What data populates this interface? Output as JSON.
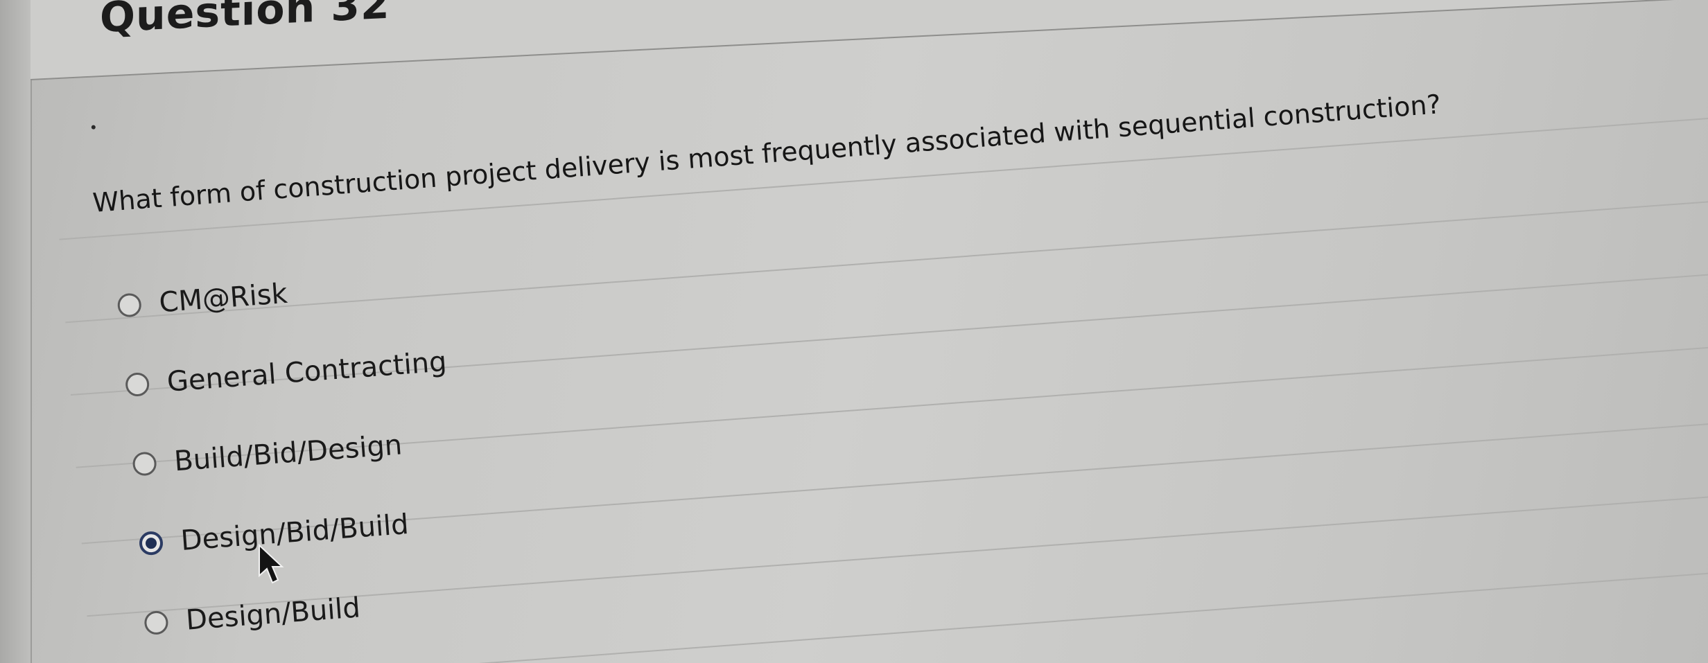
{
  "question": {
    "title": "Question 32",
    "prompt": "What form of construction project delivery is most frequently associated with sequential construction?"
  },
  "options": [
    {
      "label": "CM@Risk",
      "selected": false
    },
    {
      "label": "General Contracting",
      "selected": false
    },
    {
      "label": "Build/Bid/Design",
      "selected": false
    },
    {
      "label": "Design/Bid/Build",
      "selected": true
    },
    {
      "label": "Design/Build",
      "selected": false
    }
  ],
  "colors": {
    "radio_selected": "#1f2f55",
    "background": "#cdcdcb"
  }
}
